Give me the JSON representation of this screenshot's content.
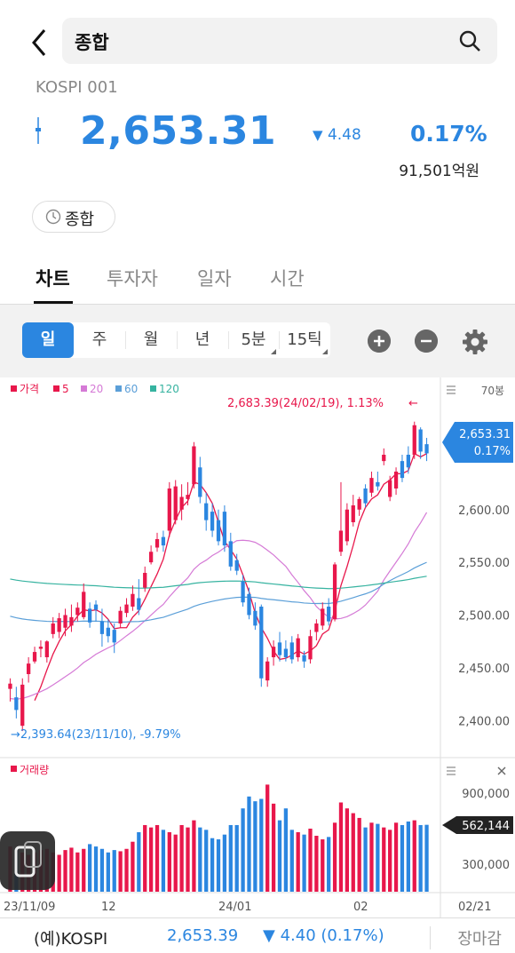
{
  "header": {
    "search_query": "종합",
    "code": "KOSPI 001"
  },
  "quote": {
    "price": "2,653.31",
    "change": "4.48",
    "change_pct": "0.17%",
    "amount": "91,501억원",
    "market_label": "종합"
  },
  "tabs": [
    {
      "label": "차트",
      "active": true
    },
    {
      "label": "투자자",
      "active": false
    },
    {
      "label": "일자",
      "active": false
    },
    {
      "label": "시간",
      "active": false
    }
  ],
  "periods": [
    {
      "label": "일",
      "active": true
    },
    {
      "label": "주",
      "active": false
    },
    {
      "label": "월",
      "active": false
    },
    {
      "label": "년",
      "active": false
    },
    {
      "label": "5분",
      "active": false
    },
    {
      "label": "15틱",
      "active": false
    }
  ],
  "chart": {
    "legend": {
      "price": "가격",
      "ma5": "5",
      "ma20": "20",
      "ma60": "60",
      "ma120": "120"
    },
    "candle_count_label": "70봉",
    "high_annotation": "2,683.39(24/02/19), 1.13%",
    "low_annotation": "→2,393.64(23/11/10), -9.79%",
    "current_price_tag": "2,653.31",
    "current_pct_tag": "0.17%",
    "y_ticks": [
      "2,600.00",
      "2,550.00",
      "2,500.00",
      "2,450.00",
      "2,400.00"
    ],
    "volume_label": "거래량",
    "volume_ticks": [
      "900,000",
      "300,000"
    ],
    "volume_tag": "562,144",
    "x_ticks": [
      "23/11/09",
      "12",
      "24/01",
      "02",
      "02/21"
    ],
    "colors": {
      "up": "#e8174b",
      "down": "#2b86e0",
      "ma5": "#e8174b",
      "ma20": "#d57ad6",
      "ma60": "#5b9fd8",
      "ma120": "#36b3a0"
    }
  },
  "chart_data": {
    "type": "candlestick",
    "title": "",
    "ylim": [
      2380,
      2700
    ],
    "candles": [
      {
        "o": 2430,
        "h": 2440,
        "l": 2418,
        "c": 2435
      },
      {
        "o": 2422,
        "h": 2432,
        "l": 2402,
        "c": 2410
      },
      {
        "o": 2395,
        "h": 2440,
        "l": 2390,
        "c": 2434
      },
      {
        "o": 2444,
        "h": 2460,
        "l": 2436,
        "c": 2454
      },
      {
        "o": 2456,
        "h": 2470,
        "l": 2454,
        "c": 2465
      },
      {
        "o": 2468,
        "h": 2476,
        "l": 2460,
        "c": 2470
      },
      {
        "o": 2460,
        "h": 2476,
        "l": 2455,
        "c": 2475
      },
      {
        "o": 2482,
        "h": 2498,
        "l": 2478,
        "c": 2492
      },
      {
        "o": 2484,
        "h": 2502,
        "l": 2478,
        "c": 2497
      },
      {
        "o": 2488,
        "h": 2506,
        "l": 2480,
        "c": 2500
      },
      {
        "o": 2490,
        "h": 2510,
        "l": 2484,
        "c": 2498
      },
      {
        "o": 2500,
        "h": 2512,
        "l": 2494,
        "c": 2507
      },
      {
        "o": 2498,
        "h": 2530,
        "l": 2496,
        "c": 2522
      },
      {
        "o": 2506,
        "h": 2512,
        "l": 2488,
        "c": 2493
      },
      {
        "o": 2510,
        "h": 2514,
        "l": 2494,
        "c": 2505
      },
      {
        "o": 2494,
        "h": 2506,
        "l": 2470,
        "c": 2482
      },
      {
        "o": 2488,
        "h": 2496,
        "l": 2474,
        "c": 2480
      },
      {
        "o": 2486,
        "h": 2492,
        "l": 2464,
        "c": 2474
      },
      {
        "o": 2492,
        "h": 2508,
        "l": 2488,
        "c": 2504
      },
      {
        "o": 2502,
        "h": 2516,
        "l": 2498,
        "c": 2510
      },
      {
        "o": 2508,
        "h": 2528,
        "l": 2504,
        "c": 2520
      },
      {
        "o": 2516,
        "h": 2534,
        "l": 2500,
        "c": 2505
      },
      {
        "o": 2526,
        "h": 2546,
        "l": 2522,
        "c": 2540
      },
      {
        "o": 2550,
        "h": 2566,
        "l": 2548,
        "c": 2560
      },
      {
        "o": 2564,
        "h": 2578,
        "l": 2560,
        "c": 2572
      },
      {
        "o": 2574,
        "h": 2580,
        "l": 2560,
        "c": 2566
      },
      {
        "o": 2580,
        "h": 2626,
        "l": 2574,
        "c": 2620
      },
      {
        "o": 2590,
        "h": 2628,
        "l": 2586,
        "c": 2622
      },
      {
        "o": 2600,
        "h": 2624,
        "l": 2590,
        "c": 2612
      },
      {
        "o": 2610,
        "h": 2626,
        "l": 2604,
        "c": 2614
      },
      {
        "o": 2624,
        "h": 2664,
        "l": 2620,
        "c": 2660
      },
      {
        "o": 2640,
        "h": 2650,
        "l": 2606,
        "c": 2612
      },
      {
        "o": 2606,
        "h": 2616,
        "l": 2580,
        "c": 2590
      },
      {
        "o": 2598,
        "h": 2606,
        "l": 2574,
        "c": 2580
      },
      {
        "o": 2590,
        "h": 2600,
        "l": 2566,
        "c": 2570
      },
      {
        "o": 2598,
        "h": 2604,
        "l": 2560,
        "c": 2566
      },
      {
        "o": 2570,
        "h": 2578,
        "l": 2542,
        "c": 2546
      },
      {
        "o": 2552,
        "h": 2558,
        "l": 2538,
        "c": 2542
      },
      {
        "o": 2532,
        "h": 2538,
        "l": 2508,
        "c": 2512
      },
      {
        "o": 2520,
        "h": 2526,
        "l": 2496,
        "c": 2500
      },
      {
        "o": 2504,
        "h": 2512,
        "l": 2486,
        "c": 2490
      },
      {
        "o": 2508,
        "h": 2510,
        "l": 2432,
        "c": 2440
      },
      {
        "o": 2438,
        "h": 2460,
        "l": 2432,
        "c": 2456
      },
      {
        "o": 2460,
        "h": 2476,
        "l": 2452,
        "c": 2470
      },
      {
        "o": 2474,
        "h": 2484,
        "l": 2456,
        "c": 2462
      },
      {
        "o": 2468,
        "h": 2476,
        "l": 2456,
        "c": 2460
      },
      {
        "o": 2474,
        "h": 2480,
        "l": 2454,
        "c": 2458
      },
      {
        "o": 2460,
        "h": 2482,
        "l": 2456,
        "c": 2478
      },
      {
        "o": 2462,
        "h": 2466,
        "l": 2450,
        "c": 2456
      },
      {
        "o": 2458,
        "h": 2486,
        "l": 2454,
        "c": 2480
      },
      {
        "o": 2484,
        "h": 2496,
        "l": 2476,
        "c": 2492
      },
      {
        "o": 2490,
        "h": 2512,
        "l": 2486,
        "c": 2506
      },
      {
        "o": 2508,
        "h": 2516,
        "l": 2490,
        "c": 2494
      },
      {
        "o": 2496,
        "h": 2550,
        "l": 2494,
        "c": 2548
      },
      {
        "o": 2560,
        "h": 2626,
        "l": 2556,
        "c": 2580
      },
      {
        "o": 2570,
        "h": 2606,
        "l": 2566,
        "c": 2600
      },
      {
        "o": 2588,
        "h": 2614,
        "l": 2584,
        "c": 2604
      },
      {
        "o": 2600,
        "h": 2612,
        "l": 2594,
        "c": 2610
      },
      {
        "o": 2620,
        "h": 2624,
        "l": 2602,
        "c": 2606
      },
      {
        "o": 2616,
        "h": 2636,
        "l": 2612,
        "c": 2630
      },
      {
        "o": 2626,
        "h": 2636,
        "l": 2618,
        "c": 2622
      },
      {
        "o": 2646,
        "h": 2658,
        "l": 2642,
        "c": 2652
      },
      {
        "o": 2612,
        "h": 2632,
        "l": 2608,
        "c": 2628
      },
      {
        "o": 2620,
        "h": 2640,
        "l": 2614,
        "c": 2636
      },
      {
        "o": 2646,
        "h": 2652,
        "l": 2626,
        "c": 2630
      },
      {
        "o": 2652,
        "h": 2660,
        "l": 2634,
        "c": 2640
      },
      {
        "o": 2652,
        "h": 2683.39,
        "l": 2648,
        "c": 2680
      },
      {
        "o": 2676,
        "h": 2678,
        "l": 2648,
        "c": 2655
      },
      {
        "o": 2662,
        "h": 2668,
        "l": 2646,
        "c": 2653.31
      }
    ],
    "volume": [
      380000,
      360000,
      330000,
      310000,
      330000,
      350000,
      360000,
      330000,
      310000,
      350000,
      370000,
      330000,
      360000,
      400000,
      380000,
      360000,
      330000,
      350000,
      340000,
      360000,
      420000,
      500000,
      560000,
      540000,
      560000,
      520000,
      500000,
      480000,
      560000,
      540000,
      600000,
      540000,
      520000,
      450000,
      440000,
      480000,
      560000,
      560000,
      700000,
      800000,
      760000,
      780000,
      900000,
      740000,
      600000,
      700000,
      520000,
      500000,
      480000,
      530000,
      470000,
      440000,
      460000,
      580000,
      750000,
      700000,
      660000,
      620000,
      540000,
      580000,
      570000,
      540000,
      520000,
      580000,
      560000,
      590000,
      600000,
      560000,
      562144
    ],
    "ma5": [
      null,
      null,
      null,
      null,
      2419,
      2432,
      2448,
      2463,
      2475,
      2485,
      2491,
      2499,
      2505,
      2504,
      2505,
      2502,
      2496,
      2487,
      2488,
      2488,
      2498,
      2504,
      2515,
      2527,
      2539,
      2553,
      2576,
      2590,
      2602,
      2608,
      2626,
      2624,
      2616,
      2606,
      2588,
      2570,
      2562,
      2553,
      2538,
      2522,
      2502,
      2488,
      2478,
      2466,
      2458,
      2459,
      2462,
      2466,
      2463,
      2466,
      2471,
      2482,
      2486,
      2504,
      2528,
      2546,
      2566,
      2588,
      2602,
      2610,
      2614,
      2624,
      2628,
      2634,
      2634,
      2637,
      2653,
      2650,
      2653
    ]
  }
}
